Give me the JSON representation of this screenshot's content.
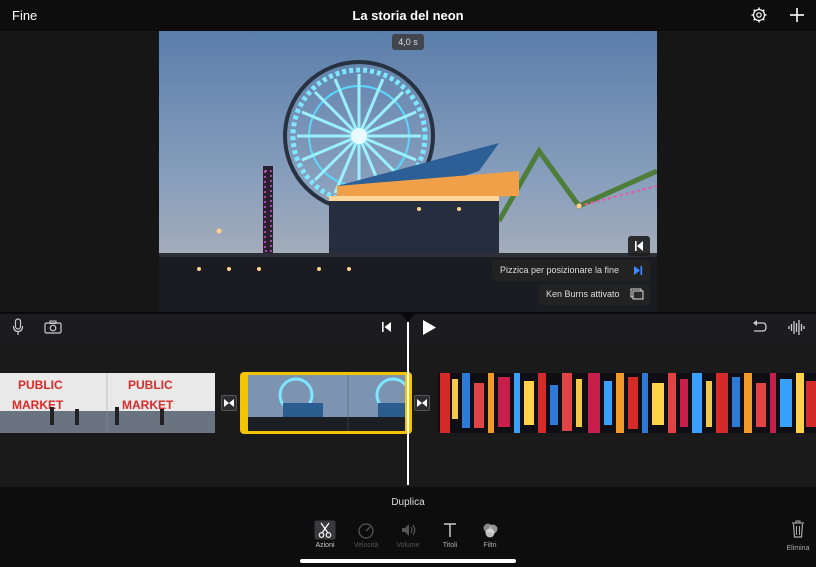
{
  "topbar": {
    "done_label": "Fine",
    "title": "La storia del neon"
  },
  "viewer": {
    "duration": "4,0 s",
    "ken_burns_end_hint": "Pizzica per posizionare la fine",
    "ken_burns_status": "Ken Burns attivato"
  },
  "toolbar": {
    "mode_label": "Duplica",
    "tools": [
      {
        "label": "Azioni",
        "icon": "scissors-icon"
      },
      {
        "label": "Velocità",
        "icon": "speedometer-icon"
      },
      {
        "label": "Volume",
        "icon": "speaker-icon"
      },
      {
        "label": "Titoli",
        "icon": "text-icon"
      },
      {
        "label": "Filtri",
        "icon": "filters-icon"
      }
    ],
    "delete_label": "Elimina"
  },
  "colors": {
    "accent": "#f5c400",
    "selected_handle": "#f5c400",
    "hint_blue": "#3b8cff"
  }
}
